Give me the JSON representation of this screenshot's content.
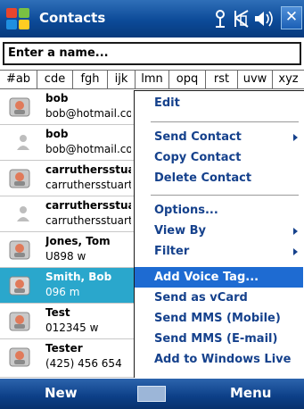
{
  "titlebar": {
    "title": "Contacts",
    "close_label": "✕"
  },
  "search": {
    "value": "Enter a name..."
  },
  "tabs": [
    "#ab",
    "cde",
    "fgh",
    "ijk",
    "lmn",
    "opq",
    "rst",
    "uvw",
    "xyz"
  ],
  "contacts": [
    {
      "name": "bob",
      "sub": "bob@hotmail.com",
      "selected": false
    },
    {
      "name": "bob",
      "sub": "bob@hotmail.com",
      "selected": false
    },
    {
      "name": "carruthersstuart",
      "sub": "carruthersstuart",
      "selected": false
    },
    {
      "name": "carruthersstuart",
      "sub": "carruthersstuart",
      "selected": false
    },
    {
      "name": "Jones, Tom",
      "sub": "U898   w",
      "selected": false
    },
    {
      "name": "Smith, Bob",
      "sub": "096   m",
      "selected": true
    },
    {
      "name": "Test",
      "sub": "012345   w",
      "selected": false
    },
    {
      "name": "Tester",
      "sub": "(425) 456 654",
      "selected": false
    }
  ],
  "menu": {
    "edit": "Edit",
    "send_contact": "Send Contact",
    "copy_contact": "Copy Contact",
    "delete_contact": "Delete Contact",
    "options": "Options...",
    "view_by": "View By",
    "filter": "Filter",
    "add_voice_tag": "Add Voice Tag...",
    "send_as_vcard": "Send as vCard",
    "send_mms_mobile": "Send MMS (Mobile)",
    "send_mms_email": "Send MMS (E-mail)",
    "add_to_windows_live": "Add to Windows Live"
  },
  "softkeys": {
    "left": "New",
    "right": "Menu"
  },
  "colors": {
    "titlebar": "#0c4a98",
    "selected_row": "#2aa7cc",
    "menu_highlight": "#1e6bd2",
    "menu_text": "#15418c"
  }
}
